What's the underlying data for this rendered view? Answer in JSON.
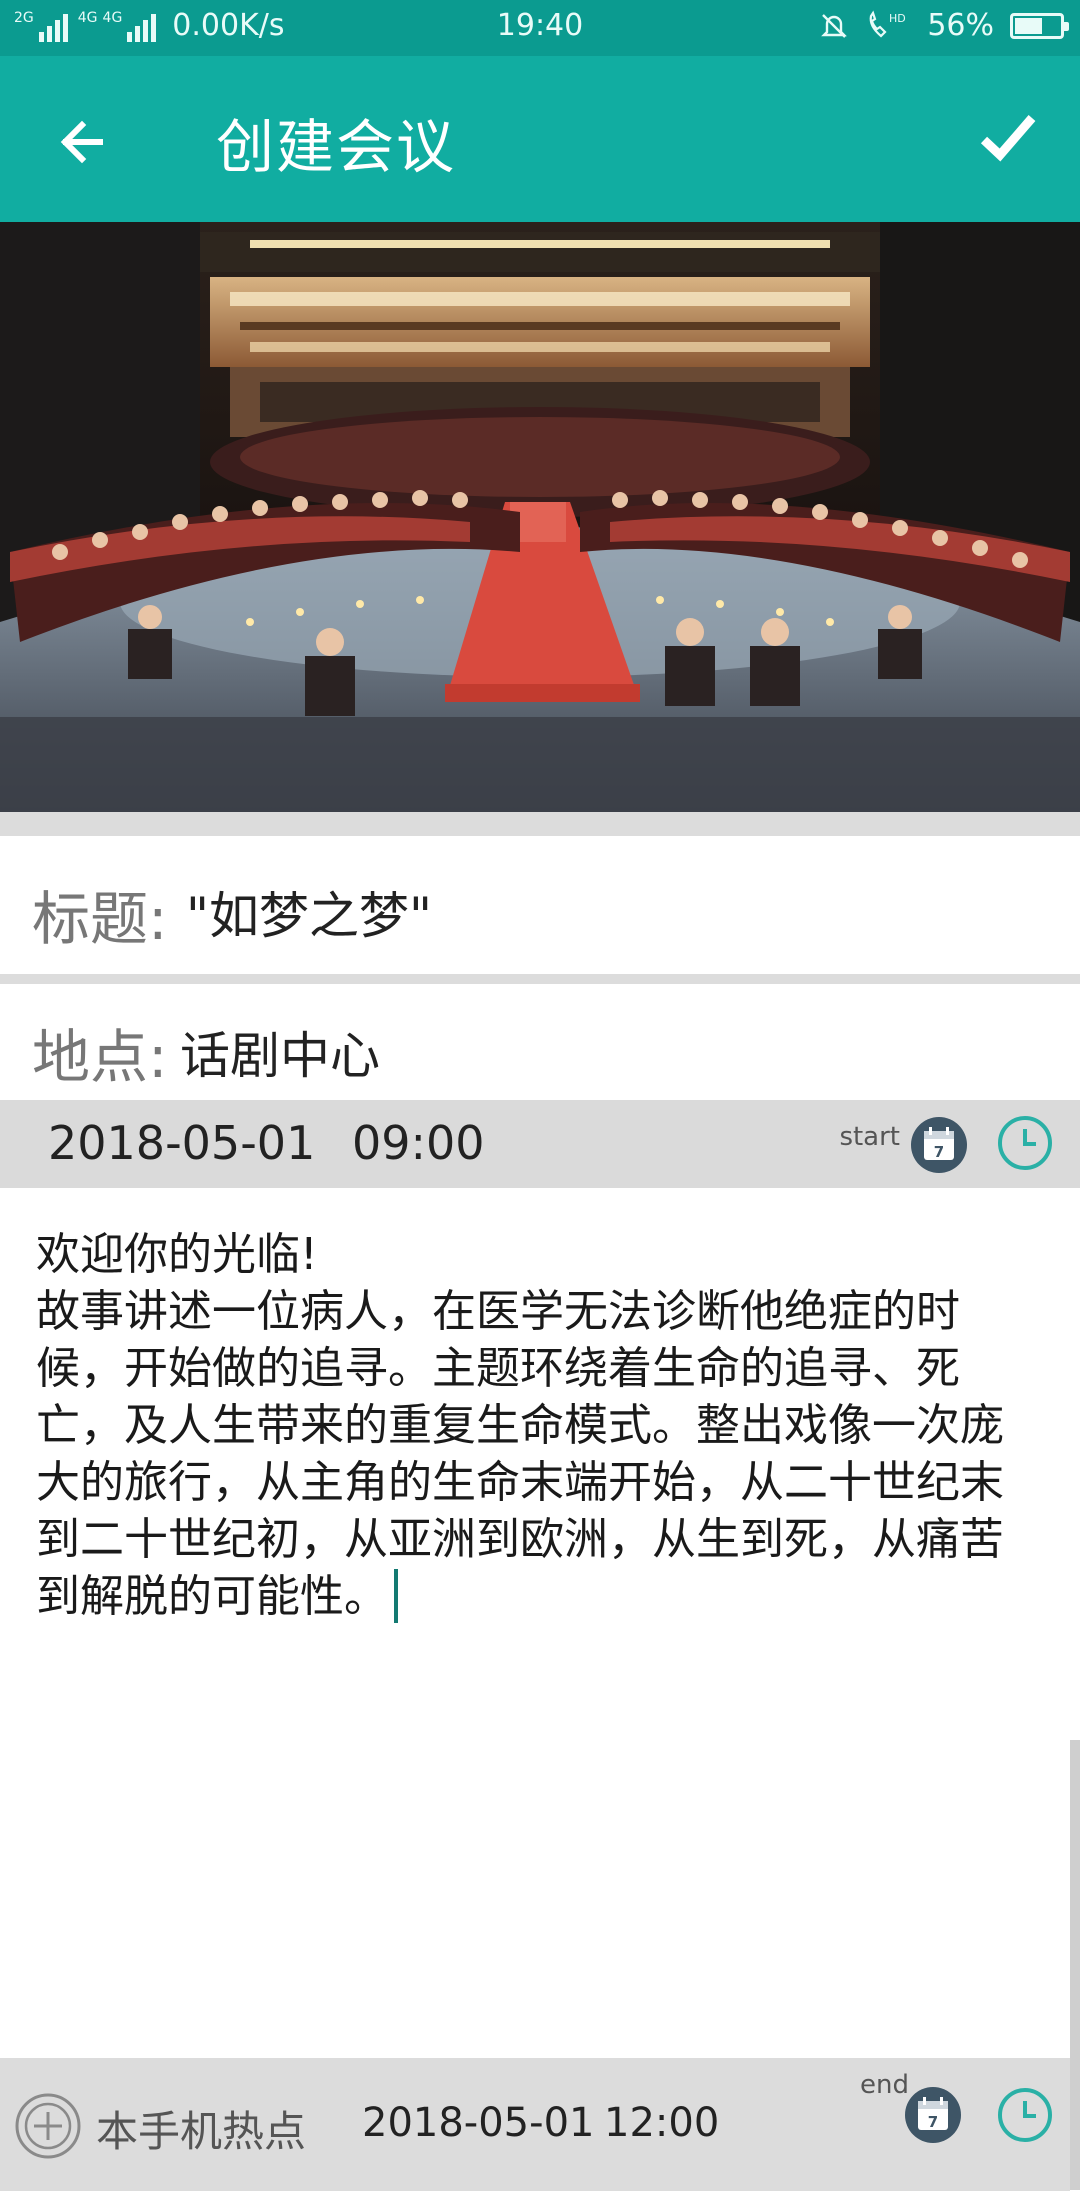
{
  "status_bar": {
    "network_1": "2G",
    "network_2": "4G",
    "network_3": "4G",
    "speed": "0.00K/s",
    "time": "19:40",
    "hd": "HD",
    "battery": "56%",
    "battery_level": 0.56
  },
  "app_bar": {
    "title": "创建会议",
    "back_icon": "arrow-left-icon",
    "confirm_icon": "checkmark-icon"
  },
  "hero_image": {
    "description_icon": "theater-stage-photo"
  },
  "form": {
    "title_label": "标题:",
    "title_value": "\"如梦之梦\"",
    "location_label": "地点:",
    "location_value": "话剧中心"
  },
  "start": {
    "date": "2018-05-01",
    "time": "09:00",
    "tag": "start",
    "calendar_day": "7"
  },
  "description": {
    "text": "欢迎你的光临!\n故事讲述一位病人，在医学无法诊断他绝症的时候，开始做的追寻。主题环绕着生命的追寻、死亡，及人生带来的重复生命模式。整出戏像一次庞大的旅行，从主角的生命末端开始，从二十世纪末到二十世纪初，从亚洲到欧洲，从生到死，从痛苦到解脱的可能性。"
  },
  "bottom_bar": {
    "hotspot_label": "本手机热点",
    "date": "2018-05-01",
    "time": "12:00",
    "tag": "end",
    "calendar_day": "7"
  },
  "colors": {
    "primary": "#11ada1",
    "status_bar": "#0b9b90",
    "accent_icon": "#2ab0a6",
    "calendar_icon": "#3e5566",
    "row_grey": "#dadada"
  }
}
